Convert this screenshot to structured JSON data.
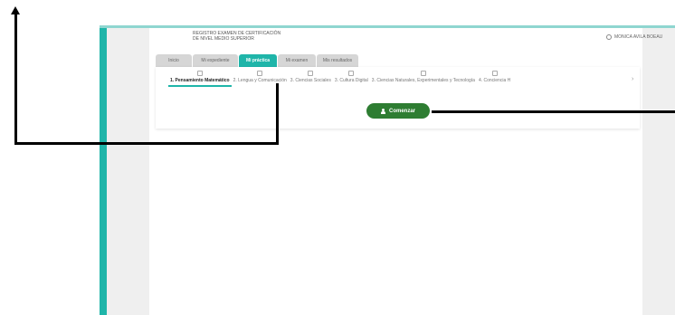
{
  "header": {
    "title_line1": "REGISTRO EXAMEN DE CERTIFICACIÓN",
    "title_line2": "DE NIVEL MEDIO SUPERIOR",
    "user_name": "MONICA AVILA BOEAU"
  },
  "tabs": [
    {
      "label": "Inicio"
    },
    {
      "label": "Mi expediente"
    },
    {
      "label": "Mi práctica"
    },
    {
      "label": "Mi examen"
    },
    {
      "label": "Mis resultados"
    }
  ],
  "subtabs": [
    {
      "label": "1. Pensamiento Matemático"
    },
    {
      "label": "2. Lengua y Comunicación"
    },
    {
      "label": "3. Ciencias Sociales"
    },
    {
      "label": "3. Cultura Digital"
    },
    {
      "label": "3. Ciencias Naturales, Experimentales y Tecnología"
    },
    {
      "label": "4. Conciencia H"
    }
  ],
  "start_button": {
    "label": "Comenzar"
  },
  "colors": {
    "accent": "#1fb5a9",
    "button": "#2e7d32"
  }
}
